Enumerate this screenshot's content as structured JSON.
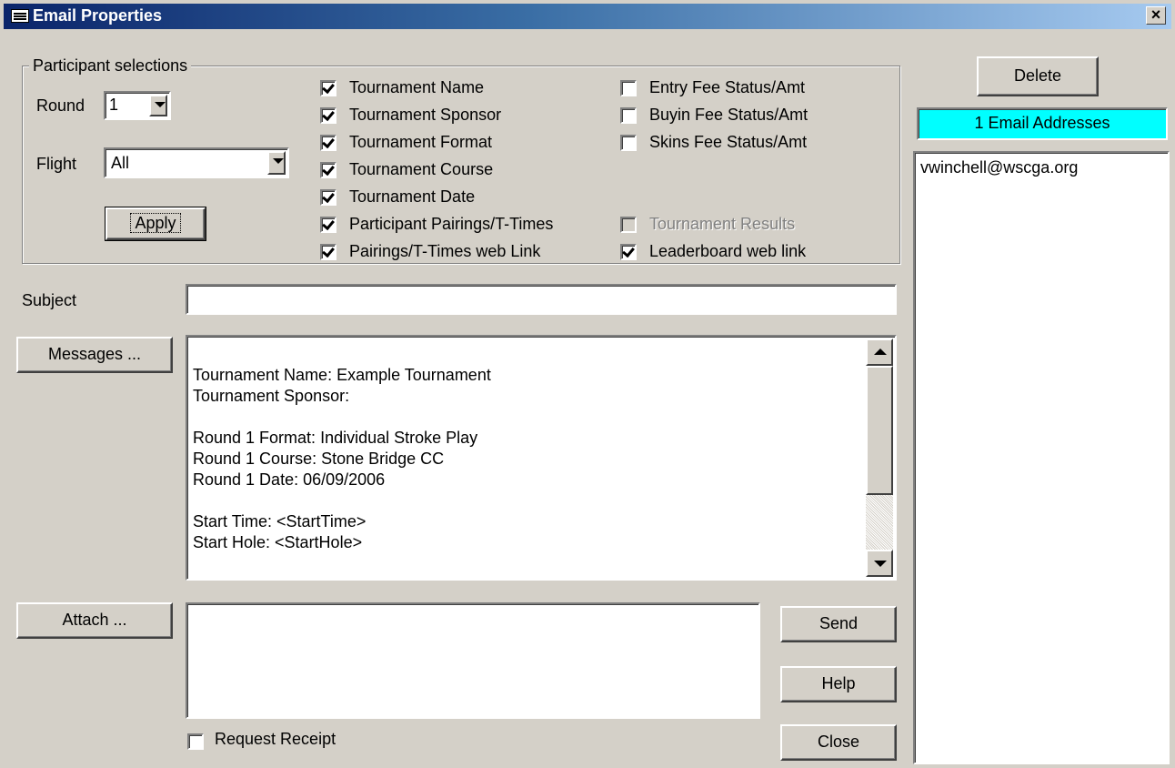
{
  "window": {
    "title": "Email Properties",
    "close_glyph": "×"
  },
  "participant": {
    "legend": "Participant selections",
    "round_label": "Round",
    "round_value": "1",
    "flight_label": "Flight",
    "flight_value": "All",
    "apply_label": "Apply"
  },
  "checkboxes_left": [
    {
      "label": "Tournament Name",
      "checked": true
    },
    {
      "label": "Tournament Sponsor",
      "checked": true
    },
    {
      "label": "Tournament Format",
      "checked": true
    },
    {
      "label": "Tournament Course",
      "checked": true
    },
    {
      "label": "Tournament Date",
      "checked": true
    },
    {
      "label": "Participant Pairings/T-Times",
      "checked": true
    },
    {
      "label": "Pairings/T-Times web Link",
      "checked": true
    }
  ],
  "checkboxes_right": [
    {
      "label": "Entry Fee Status/Amt",
      "checked": false
    },
    {
      "label": "Buyin Fee Status/Amt",
      "checked": false
    },
    {
      "label": "Skins Fee Status/Amt",
      "checked": false
    },
    {
      "label": "Tournament Results",
      "checked": false,
      "disabled": true
    },
    {
      "label": "Leaderboard web link",
      "checked": true
    }
  ],
  "subject": {
    "label": "Subject",
    "value": ""
  },
  "messages": {
    "button_label": "Messages ...",
    "lines": [
      "",
      "Tournament Name: Example Tournament",
      "Tournament Sponsor:",
      "",
      "Round 1 Format: Individual Stroke Play",
      "Round 1 Course: Stone Bridge CC",
      "Round 1 Date: 06/09/2006",
      "",
      "Start Time: <StartTime>",
      "Start Hole: <StartHole>"
    ]
  },
  "attach": {
    "button_label": "Attach ...",
    "value": ""
  },
  "request_receipt": {
    "label": "Request Receipt",
    "checked": false
  },
  "actions": {
    "send_label": "Send",
    "help_label": "Help",
    "close_label": "Close",
    "delete_label": "Delete"
  },
  "email_list": {
    "count_label": "1 Email Addresses",
    "count_color": "#00ffff",
    "addresses": [
      "vwinchell@wscga.org"
    ]
  }
}
